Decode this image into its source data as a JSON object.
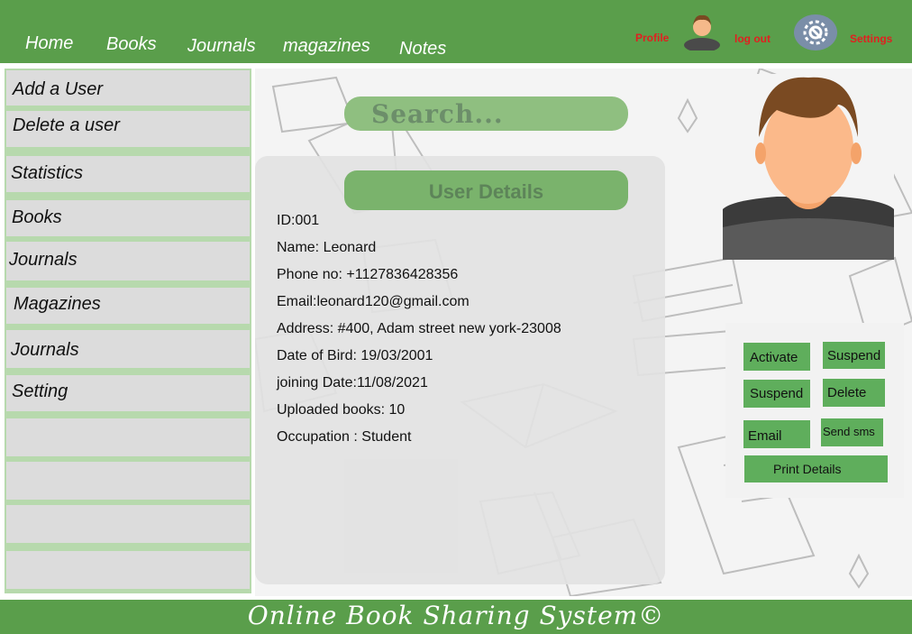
{
  "nav": {
    "items": [
      "Home",
      "Books",
      "Journals",
      "magazines",
      "Notes"
    ],
    "profile_label": "Profile",
    "logout_label": "log out",
    "settings_label": "Settings"
  },
  "sidebar": {
    "items": [
      "Add  a User",
      "Delete a user",
      "Statistics",
      "Books",
      "Journals",
      "Magazines",
      "Journals",
      "Setting"
    ]
  },
  "search": {
    "placeholder": "Search..."
  },
  "user_details": {
    "title": "User Details",
    "lines": [
      "ID:001",
      "Name: Leonard",
      "Phone no: +1127836428356",
      "Email:leonard120@gmail.com",
      "Address: #400, Adam street new york-23008",
      "Date of Bird: 19/03/2001",
      "joining Date:11/08/2021",
      "Uploaded books: 10",
      "Occupation : Student"
    ]
  },
  "actions": {
    "activate": "Activate",
    "suspend_1": "Suspend",
    "suspend_2": "Suspend",
    "delete": "Delete",
    "email": "Email",
    "send_sms": "Send sms",
    "print": "Print Details"
  },
  "footer": {
    "text": "Online Book Sharing System©"
  },
  "colors": {
    "brand_green": "#5a9e4b",
    "button_green": "#5fae5c",
    "alert_red": "#e02020"
  },
  "icons": [
    "profile-avatar-icon",
    "settings-gear-icon",
    "user-avatar-image"
  ]
}
